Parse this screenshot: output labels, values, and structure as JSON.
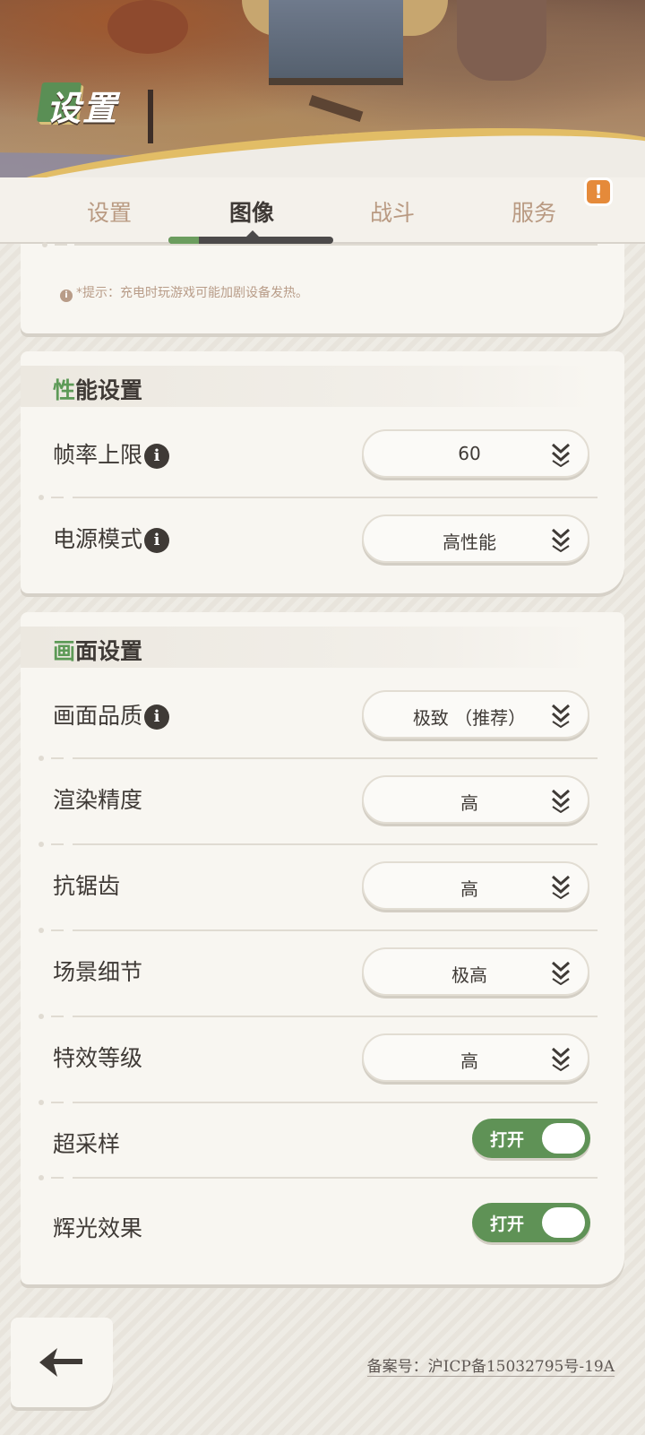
{
  "header": {
    "title_first": "设",
    "title_rest": "置"
  },
  "tabs": [
    {
      "label": "设置"
    },
    {
      "label": "图像"
    },
    {
      "label": "战斗"
    },
    {
      "label": "服务"
    }
  ],
  "alert_badge": "!",
  "hint": {
    "icon": "i",
    "text": "*提示：充电时玩游戏可能加剧设备发热。"
  },
  "performance": {
    "title_first": "性",
    "title_rest": "能设置",
    "frame_rate": {
      "label": "帧率上限",
      "value": "60"
    },
    "power_mode": {
      "label": "电源模式",
      "value": "高性能"
    }
  },
  "graphics": {
    "title_first": "画",
    "title_rest": "面设置",
    "quality": {
      "label": "画面品质",
      "value": "极致 （推荐）"
    },
    "render_precision": {
      "label": "渲染精度",
      "value": "高"
    },
    "anti_aliasing": {
      "label": "抗锯齿",
      "value": "高"
    },
    "scene_detail": {
      "label": "场景细节",
      "value": "极高"
    },
    "effects_level": {
      "label": "特效等级",
      "value": "高"
    },
    "supersampling": {
      "label": "超采样",
      "toggle": "打开"
    },
    "bloom": {
      "label": "辉光效果",
      "toggle": "打开"
    }
  },
  "info_icon": "i",
  "footer": {
    "icp": "备案号：沪ICP备15032795号-19A"
  },
  "colors": {
    "accent_green": "#5f9256",
    "text": "#3f3a36",
    "tab_inactive": "#b99a82"
  }
}
